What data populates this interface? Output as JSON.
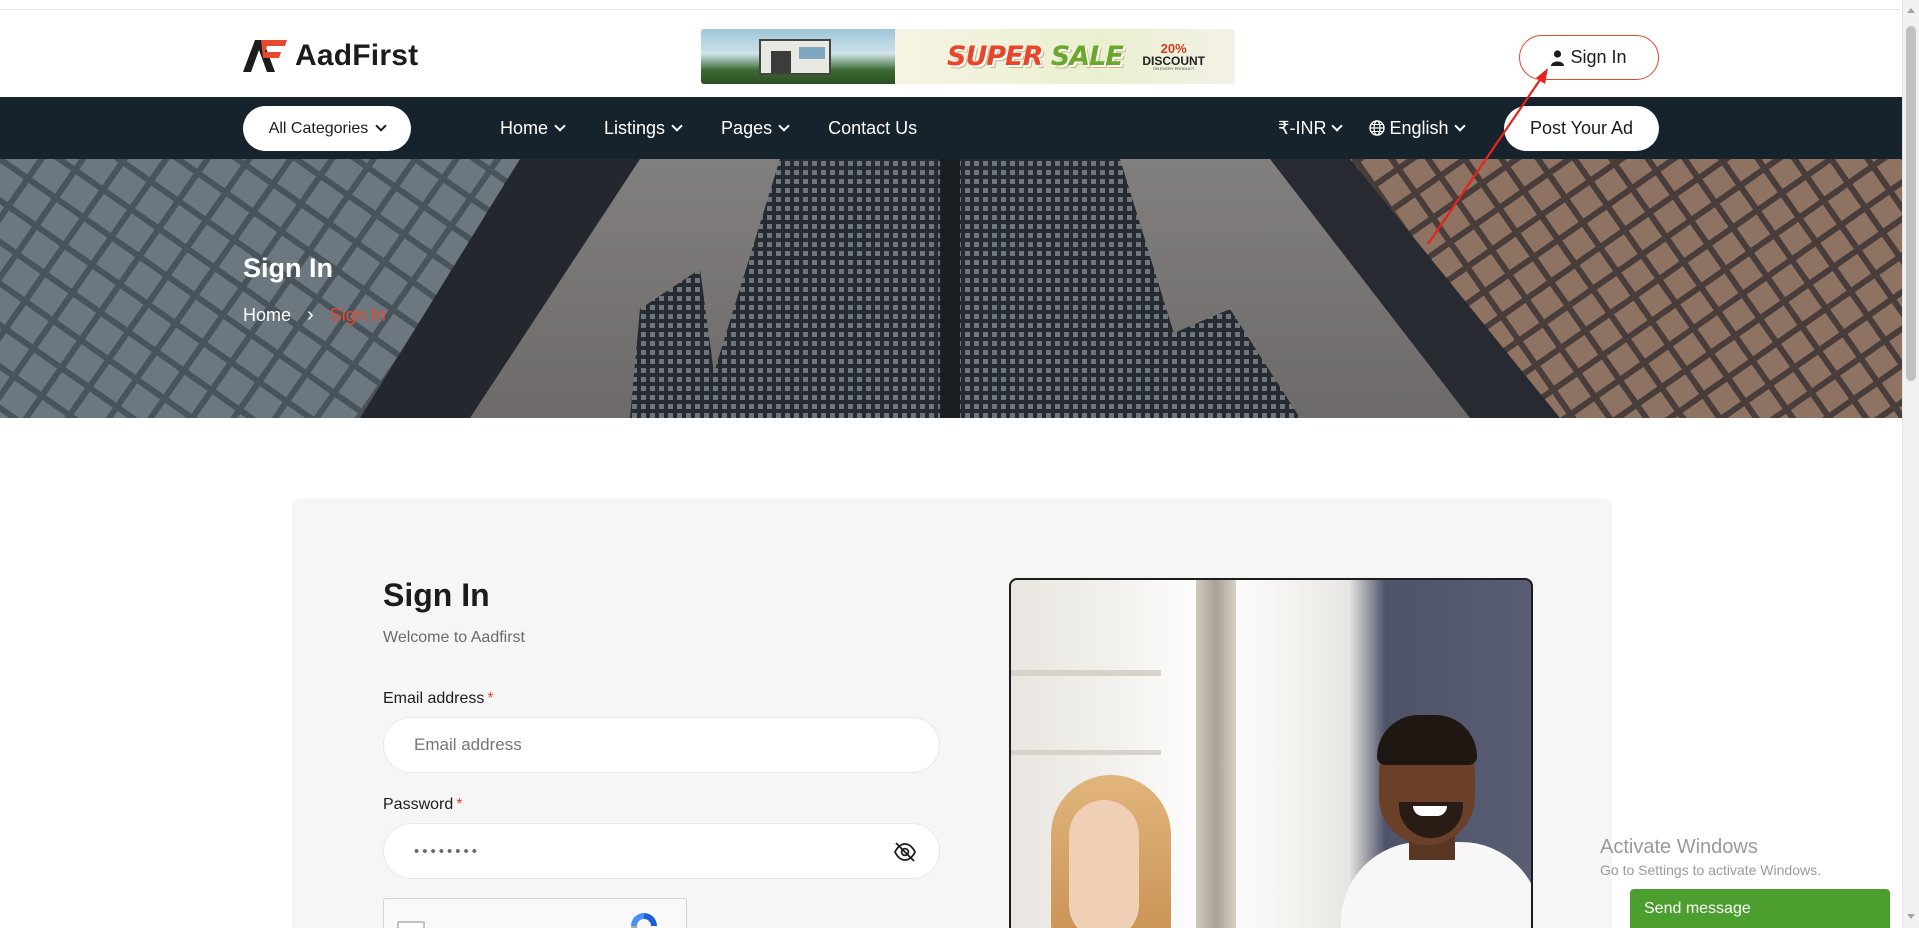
{
  "header": {
    "logo_text": "AadFirst",
    "banner": {
      "sale_word1": "SUPER",
      "sale_word2": "SALE",
      "discount_percent": "20%",
      "discount_label": "DISCOUNT",
      "discount_small": "ON EVERY PRODUCT"
    },
    "signin_label": "Sign In"
  },
  "navbar": {
    "all_categories": "All Categories",
    "links": [
      {
        "label": "Home"
      },
      {
        "label": "Listings"
      },
      {
        "label": "Pages"
      },
      {
        "label": "Contact Us"
      }
    ],
    "currency": "₹-INR",
    "language": "English",
    "post_ad": "Post Your Ad"
  },
  "hero": {
    "title": "Sign In",
    "breadcrumb_home": "Home",
    "breadcrumb_separator": "›",
    "breadcrumb_current": "Sign In"
  },
  "form": {
    "title": "Sign In",
    "subtitle": "Welcome to Aadfirst",
    "email_label": "Email address",
    "email_placeholder": "Email address",
    "password_label": "Password",
    "password_value": "••••••••",
    "required_mark": "*"
  },
  "overlay": {
    "activate_title": "Activate Windows",
    "activate_sub": "Go to Settings to activate Windows.",
    "send_message": "Send message"
  },
  "colors": {
    "accent": "#e64a2e",
    "navbar_bg": "#16222c",
    "send_message_bg": "#4c9e2e"
  }
}
